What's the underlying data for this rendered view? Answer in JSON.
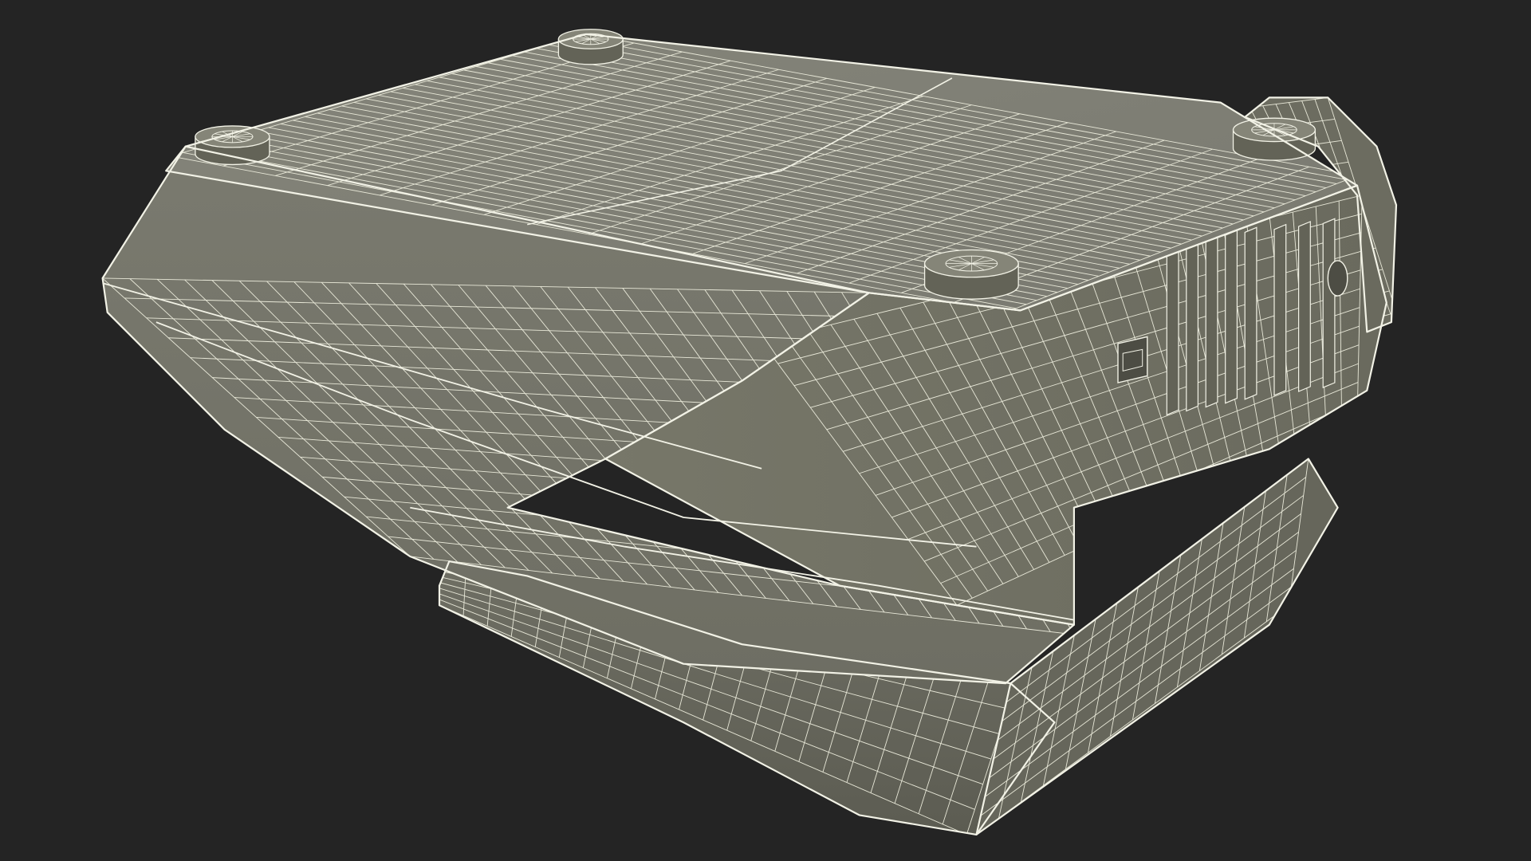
{
  "scene": {
    "subject": "",
    "render_style": "wireframe-over-shaded",
    "colors": {
      "background": "#242424",
      "surface": "#7a7a6e",
      "surface_light": "#858578",
      "surface_dark": "#636357",
      "shadow": "#4d4d44",
      "wire": "#f2f2e6",
      "wire_faint": "#e8e8d8"
    }
  }
}
